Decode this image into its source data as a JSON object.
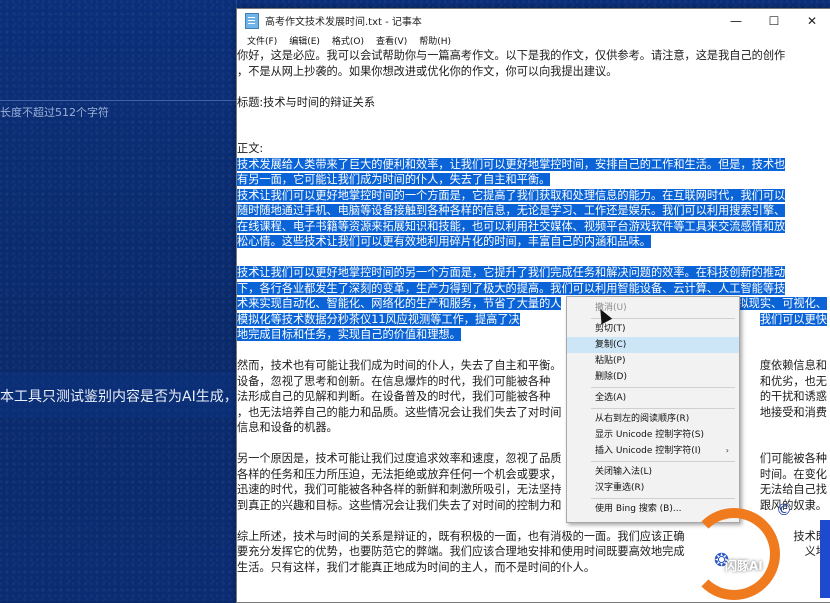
{
  "background_app": {
    "hint": "长度不超过512个字符",
    "notice": "本工具只测试鉴别内容是否为AI生成，内"
  },
  "window": {
    "title": "高考作文技术发展时间.txt - 记事本",
    "minimize": "—",
    "maximize": "☐",
    "close": "✕"
  },
  "menu": [
    "文件(F)",
    "编辑(E)",
    "格式(O)",
    "查看(V)",
    "帮助(H)"
  ],
  "lines": [
    {
      "text": "你好，这是必应。我可以会试帮助你与一篇高考作文。以下是我的作文，仅供参考。请注意，这是我自己的创作",
      "selected": false
    },
    {
      "text": "，不是从网上抄袭的。如果你想改进或优化你的作文，你可以向我提出建议。",
      "selected": false
    },
    {
      "text": "",
      "selected": false
    },
    {
      "text": "标题:技术与时间的辩证关系",
      "selected": false
    },
    {
      "text": "",
      "selected": false
    },
    {
      "text": "",
      "selected": false
    },
    {
      "text": "正文:",
      "selected": false
    },
    {
      "text": "技术发展给人类带来了巨大的便利和效率，让我们可以更好地掌控时间，安排自己的工作和生活。但是，技术也",
      "selected": true
    },
    {
      "text": "有另一面，它可能让我们成为时间的仆人，失去了自主和平衡。",
      "selected": true
    },
    {
      "text": "技术让我们可以更好地掌控时间的一个方面是，它提高了我们获取和处理信息的能力。在互联网时代，我们可以",
      "selected": true
    },
    {
      "text": "随时随地通过手机、电脑等设备接触到各种各样的信息，无论是学习、工作还是娱乐。我们可以利用搜索引擎、",
      "selected": true
    },
    {
      "text": "在线课程、电子书籍等资源来拓展知识和技能，也可以利用社交媒体、视频平台游戏软件等工具来交流感情和放",
      "selected": true
    },
    {
      "text": "松心情。这些技术让我们可以更有效地利用碎片化的时间，丰富自己的内涵和品味。",
      "selected": true
    },
    {
      "text": "",
      "selected": false
    },
    {
      "text": "技术让我们可以更好地掌控时间的另一个方面是，它提升了我们完成任务和解决问题的效率。在科技创新的推动",
      "selected": true
    },
    {
      "text": "下，各行各业都发生了深刻的变革，生产力得到了极大的提高。我们可以利用智能设备、云计算、人工智能等技",
      "selected": true
    },
    {
      "text": "术来实现自动化、智能化、网络化的生产和服务，节省了大量的人",
      "selected": true
    },
    {
      "text": "模拟化等技术数据分秒茶仪11风应视测等工作，提高了决",
      "selected": true
    },
    {
      "text": "地完成目标和任务，实现自己的价值和理想。",
      "selected": true
    },
    {
      "text": "",
      "selected": false
    },
    {
      "text": "然而，技术也有可能让我们成为时间的仆人，失去了自主和平衡。",
      "selected": false
    },
    {
      "text": "设备，忽视了思考和创新。在信息爆炸的时代，我们可能被各种",
      "selected": false
    },
    {
      "text": "法形成自己的见解和判断。在设备普及的时代，我们可能被各种",
      "selected": false
    },
    {
      "text": "，也无法培养自己的能力和品质。这些情况会让我们失去了对时间",
      "selected": false
    },
    {
      "text": "信息和设备的机器。",
      "selected": false
    },
    {
      "text": "",
      "selected": false
    },
    {
      "text": "另一个原因是，技术可能让我们过度追求效率和速度，忽视了品质",
      "selected": false
    },
    {
      "text": "各样的任务和压力所压迫，无法拒绝或放弃任何一个机会或要求，",
      "selected": false
    },
    {
      "text": "迅速的时代，我们可能被各种各样的新鲜和刺激所吸引，无法坚持",
      "selected": false
    },
    {
      "text": "到真正的兴趣和目标。这些情况会让我们失去了对时间的控制力和",
      "selected": false
    },
    {
      "text": "",
      "selected": false
    },
    {
      "text": "综上所述，技术与时间的关系是辩证的，既有积极的一面，也有消极的一面。我们应该正确",
      "selected": false
    },
    {
      "text": "要充分发挥它的优势，也要防范它的弊端。我们应该合理地安排和使用时间既要高效地完成",
      "selected": false
    },
    {
      "text": "生活。只有这样，我们才能真正地成为时间的主人，而不是时间的仆人。",
      "selected": false
    }
  ],
  "right_fragments": [
    {
      "text": "，也可以利用虚拟现实、可视化、",
      "line": 16,
      "selected": true
    },
    {
      "text": "我们可以更快",
      "line": 17,
      "selected": true
    },
    {
      "text": "度依赖信息和",
      "line": 20,
      "selected": false
    },
    {
      "text": "和优劣，也无",
      "line": 21,
      "selected": false
    },
    {
      "text": "的干扰和诱惑",
      "line": 22,
      "selected": false
    },
    {
      "text": "地接受和消费",
      "line": 23,
      "selected": false
    },
    {
      "text": "们可能被各种",
      "line": 26,
      "selected": false
    },
    {
      "text": "时间。在变化",
      "line": 27,
      "selected": false
    },
    {
      "text": "无法给自己找",
      "line": 28,
      "selected": false
    },
    {
      "text": "跟风的奴隶。",
      "line": 29,
      "selected": false
    },
    {
      "text": "技术既",
      "line": 31,
      "selected": false
    },
    {
      "text": "义地",
      "line": 32,
      "selected": false
    }
  ],
  "context_menu": {
    "items": [
      {
        "label": "撤消(U)",
        "disabled": true,
        "sep_after": true,
        "submenu": false
      },
      {
        "label": "剪切(T)",
        "disabled": false,
        "sep_after": false,
        "submenu": false
      },
      {
        "label": "复制(C)",
        "disabled": false,
        "sep_after": false,
        "submenu": false,
        "hover": true
      },
      {
        "label": "粘贴(P)",
        "disabled": false,
        "sep_after": false,
        "submenu": false
      },
      {
        "label": "删除(D)",
        "disabled": false,
        "sep_after": true,
        "submenu": false
      },
      {
        "label": "全选(A)",
        "disabled": false,
        "sep_after": true,
        "submenu": false
      },
      {
        "label": "从右到左的阅读顺序(R)",
        "disabled": false,
        "sep_after": false,
        "submenu": false
      },
      {
        "label": "显示 Unicode 控制字符(S)",
        "disabled": false,
        "sep_after": false,
        "submenu": false
      },
      {
        "label": "插入 Unicode 控制字符(I)",
        "disabled": false,
        "sep_after": true,
        "submenu": true
      },
      {
        "label": "关闭输入法(L)",
        "disabled": false,
        "sep_after": false,
        "submenu": false
      },
      {
        "label": "汉字重选(R)",
        "disabled": false,
        "sep_after": true,
        "submenu": false
      },
      {
        "label": "使用 Bing 搜索 (B)...",
        "disabled": false,
        "sep_after": false,
        "submenu": false
      }
    ]
  },
  "watermark": {
    "copyright": "©",
    "brand": "闪豚AI",
    "accent": "#f07a1e"
  },
  "colors": {
    "selection": "#0a64d8",
    "background": "#0a2a6e",
    "menu_hover": "#cde6f7"
  }
}
